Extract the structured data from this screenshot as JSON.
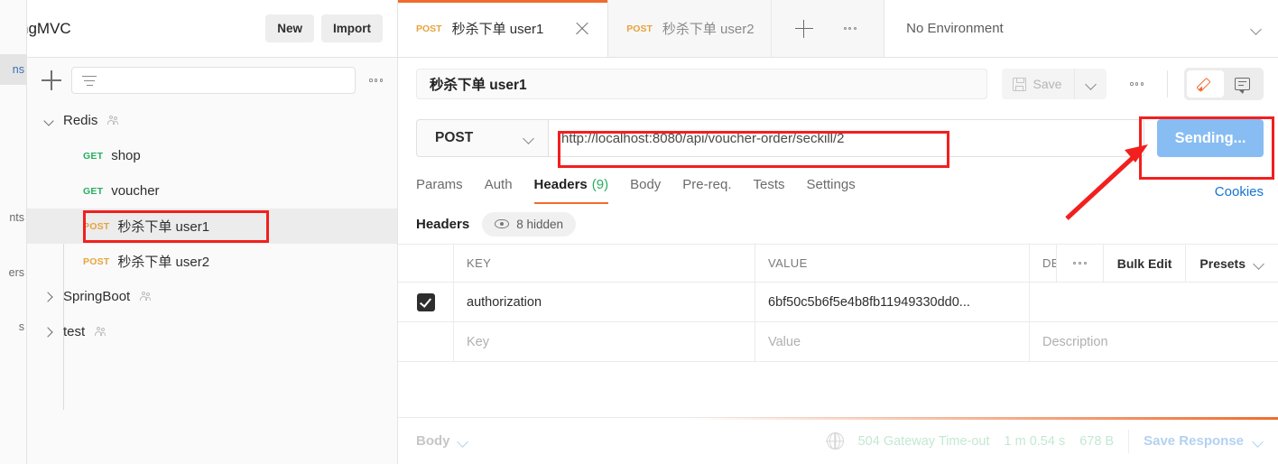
{
  "workspace": {
    "title": "ngMVC",
    "new_label": "New",
    "import_label": "Import"
  },
  "rail": {
    "items": [
      {
        "label": "ns",
        "name": "collections",
        "active": true
      },
      {
        "label": "nts",
        "name": "environments",
        "active": false
      },
      {
        "label": "ers",
        "name": "mock-servers",
        "active": false
      },
      {
        "label": "s",
        "name": "history",
        "active": false
      }
    ]
  },
  "sidebar": {
    "filter_placeholder": "",
    "tree": [
      {
        "type": "folder",
        "label": "Redis",
        "expanded": true,
        "shared": true
      },
      {
        "type": "request",
        "method": "GET",
        "label": "shop",
        "selected": false,
        "highlighted": false
      },
      {
        "type": "request",
        "method": "GET",
        "label": "voucher",
        "selected": false,
        "highlighted": false
      },
      {
        "type": "request",
        "method": "POST",
        "label": "秒杀下单 user1",
        "selected": true,
        "highlighted": true
      },
      {
        "type": "request",
        "method": "POST",
        "label": "秒杀下单 user2",
        "selected": false,
        "highlighted": false
      },
      {
        "type": "folder",
        "label": "SpringBoot",
        "expanded": false,
        "shared": true
      },
      {
        "type": "folder",
        "label": "test",
        "expanded": false,
        "shared": true
      }
    ]
  },
  "tabs": {
    "items": [
      {
        "method": "POST",
        "label": "秒杀下单 user1",
        "active": true
      },
      {
        "method": "POST",
        "label": "秒杀下单 user2",
        "active": false
      }
    ],
    "environment": "No Environment"
  },
  "request": {
    "name": "秒杀下单 user1",
    "save_label": "Save",
    "method": "POST",
    "url": "http://localhost:8080/api/voucher-order/seckill/2",
    "send_label": "Sending...",
    "tabs": [
      {
        "label": "Params",
        "active": false
      },
      {
        "label": "Auth",
        "active": false
      },
      {
        "label": "Headers",
        "count": "(9)",
        "active": true
      },
      {
        "label": "Body",
        "active": false
      },
      {
        "label": "Pre-req.",
        "active": false
      },
      {
        "label": "Tests",
        "active": false
      },
      {
        "label": "Settings",
        "active": false
      }
    ],
    "cookies_label": "Cookies"
  },
  "headers_section": {
    "label": "Headers",
    "hidden_pill": "8 hidden",
    "columns": {
      "key": "KEY",
      "value": "VALUE",
      "description": "DES"
    },
    "actions": {
      "bulk_edit": "Bulk Edit",
      "presets": "Presets"
    },
    "rows": [
      {
        "checked": true,
        "key": "authorization",
        "value": "6bf50c5b6f5e4b8fb11949330dd0...",
        "description": ""
      }
    ],
    "empty_row": {
      "key_placeholder": "Key",
      "value_placeholder": "Value",
      "description_placeholder": "Description"
    }
  },
  "footer": {
    "body_label": "Body",
    "status": "504 Gateway Time-out",
    "time": "1 m 0.54 s",
    "size": "678 B",
    "save_response": "Save Response"
  },
  "colors": {
    "accent": "#f06c2e",
    "annotation": "#f21f1f",
    "sending": "#87bdf2",
    "link": "#1474d4",
    "get": "#27ae60",
    "post": "#e8a33d"
  }
}
